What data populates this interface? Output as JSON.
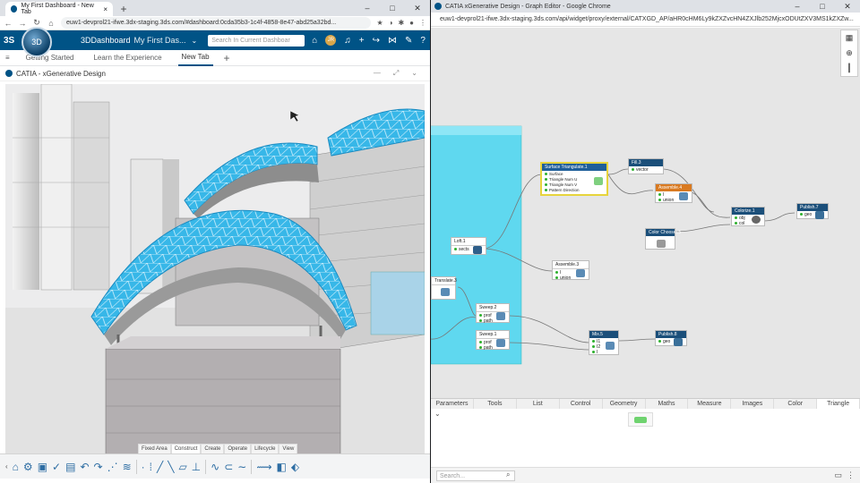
{
  "left": {
    "tab_title": "My First Dashboard - New Tab",
    "url": "euw1-devprol21-ifwe.3dx-staging.3ds.com/#dashboard:0cda35b3-1c4f-4858-8e47-abd25a32bd...",
    "ds_logo": "3S",
    "compass_label": "3D",
    "app_name": "3DDashboard",
    "dashboard_name": "My First Das...",
    "search_placeholder": "Search In Current Dashboar",
    "avatar": "JR",
    "tabs": [
      "Getting Started",
      "Learn the Experience",
      "New Tab"
    ],
    "widget_title": "CATIA - xGenerative Design",
    "ribbon_tabs": [
      "Fixed Area",
      "Construct",
      "Create",
      "Operate",
      "Lifecycle",
      "View"
    ],
    "ribbon_active": "Construct"
  },
  "right": {
    "window_title": "CATIA xGenerative Design - Graph Editor - Google Chrome",
    "url": "euw1-devprol21-ifwe.3dx-staging.3ds.com/api/widget/proxy/external/CATXGD_AP/aHR0cHM6Ly9kZXZvcHN4ZXJlb252MjcxODUtZXV3MS1kZXZw...",
    "categories": [
      "Parameters",
      "Tools",
      "List",
      "Control",
      "Geometry",
      "Maths",
      "Measure",
      "Images",
      "Color",
      "Triangle"
    ],
    "active_category": "Triangle",
    "search_placeholder": "Search..."
  },
  "nodes": [
    {
      "title": "Surface Triangulate.1",
      "rows": [
        "Surface",
        "Triangle Num U",
        "Triangle Num V",
        "Pattern Direction"
      ]
    },
    {
      "title": "Fill.3",
      "rows": [
        "vector"
      ]
    },
    {
      "title": "Assemble.4",
      "rows": [
        "I",
        "union"
      ]
    },
    {
      "title": "Color Chooser.5",
      "rows": [
        ""
      ]
    },
    {
      "title": "Colorize.1",
      "rows": [
        "obj",
        "col"
      ]
    },
    {
      "title": "Publish.7",
      "rows": [
        "geo"
      ]
    },
    {
      "title": "Loft.1",
      "rows": [
        "sects"
      ]
    },
    {
      "title": "Assemble.3",
      "rows": [
        "I",
        "union"
      ]
    },
    {
      "title": "Translate.3",
      "rows": [
        ""
      ]
    },
    {
      "title": "Sweep.2",
      "rows": [
        "prof",
        "path"
      ]
    },
    {
      "title": "Sweep.1",
      "rows": [
        "prof",
        "path"
      ]
    },
    {
      "title": "Mix.5",
      "rows": [
        "I1",
        "I2",
        "I"
      ]
    },
    {
      "title": "Publish.8",
      "rows": [
        "geo"
      ]
    }
  ],
  "colors": {
    "ds_blue": "#005386",
    "node_header": "#1b4f7a",
    "group_cyan": "#5fd8ef",
    "mesh_cyan": "#37b7e8"
  }
}
